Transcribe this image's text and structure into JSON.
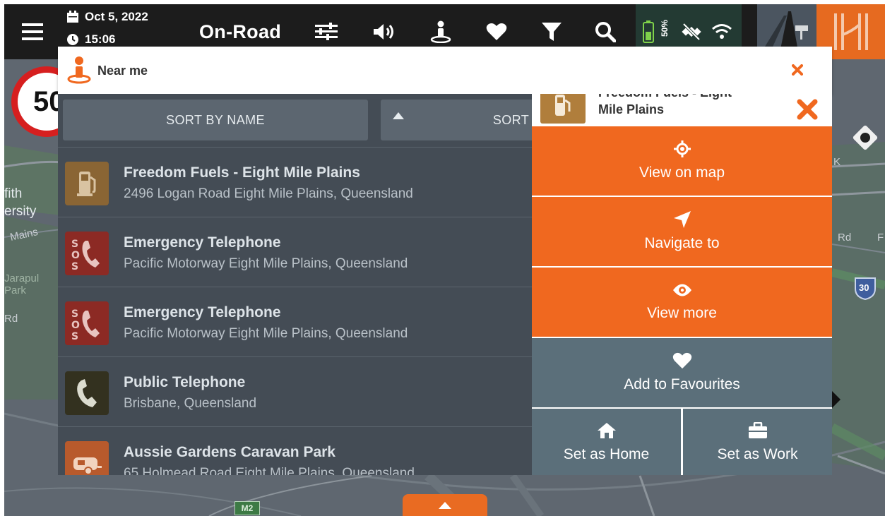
{
  "status_bar": {
    "date": "Oct 5, 2022",
    "time": "15:06",
    "mode": "On-Road",
    "battery_percent": "50%",
    "colors": {
      "bar": "#1c1c1c",
      "battery": "#7fd24a",
      "brand": "#e66a20"
    },
    "icons": [
      "menu-icon",
      "calendar-icon",
      "clock-icon",
      "sliders-icon",
      "volume-icon",
      "near-me-icon",
      "heart-icon",
      "filter-icon",
      "search-icon",
      "battery-icon",
      "gps-off-icon",
      "wifi-icon",
      "road-view-icon",
      "app-logo-icon"
    ]
  },
  "map": {
    "speed_limit": "50",
    "labels": [
      "fith",
      "ersity",
      "Mains",
      "Jarapul",
      "Park",
      "Rd",
      "K",
      "Rd",
      "F"
    ],
    "route_shield": "30",
    "road_shield": "M2"
  },
  "near_me": {
    "title": "Near me",
    "sort_by_name": "SORT BY NAME",
    "sort_by_distance": "SORT BY",
    "items": [
      {
        "name": "Freedom Fuels - Eight Mile Plains",
        "address": "2496 Logan Road Eight Mile Plains, Queensland",
        "icon": "fuel-icon",
        "color": "#b07e3c"
      },
      {
        "name": "Emergency Telephone",
        "address": "Pacific Motorway Eight Mile Plains, Queensland",
        "icon": "sos-phone-icon",
        "color": "#a32a22"
      },
      {
        "name": "Emergency Telephone",
        "address": "Pacific Motorway Eight Mile Plains, Queensland",
        "icon": "sos-phone-icon",
        "color": "#a32a22"
      },
      {
        "name": "Public Telephone",
        "address": "Brisbane, Queensland",
        "icon": "phone-icon",
        "color": "#3e3a25"
      },
      {
        "name": "Aussie Gardens Caravan Park",
        "address": "65 Holmead Road Eight Mile Plains, Queensland",
        "icon": "caravan-icon",
        "color": "#d9632a"
      }
    ]
  },
  "context_menu": {
    "title_line1": "Freedom Fuels - Eight",
    "title_line2": "Mile Plains",
    "view_on_map": "View on map",
    "navigate_to": "Navigate to",
    "view_more": "View more",
    "add_to_favourites": "Add to Favourites",
    "set_as_home": "Set as Home",
    "set_as_work": "Set as Work",
    "colors": {
      "primary": "#f0681f",
      "secondary": "#5b6f7a"
    }
  }
}
